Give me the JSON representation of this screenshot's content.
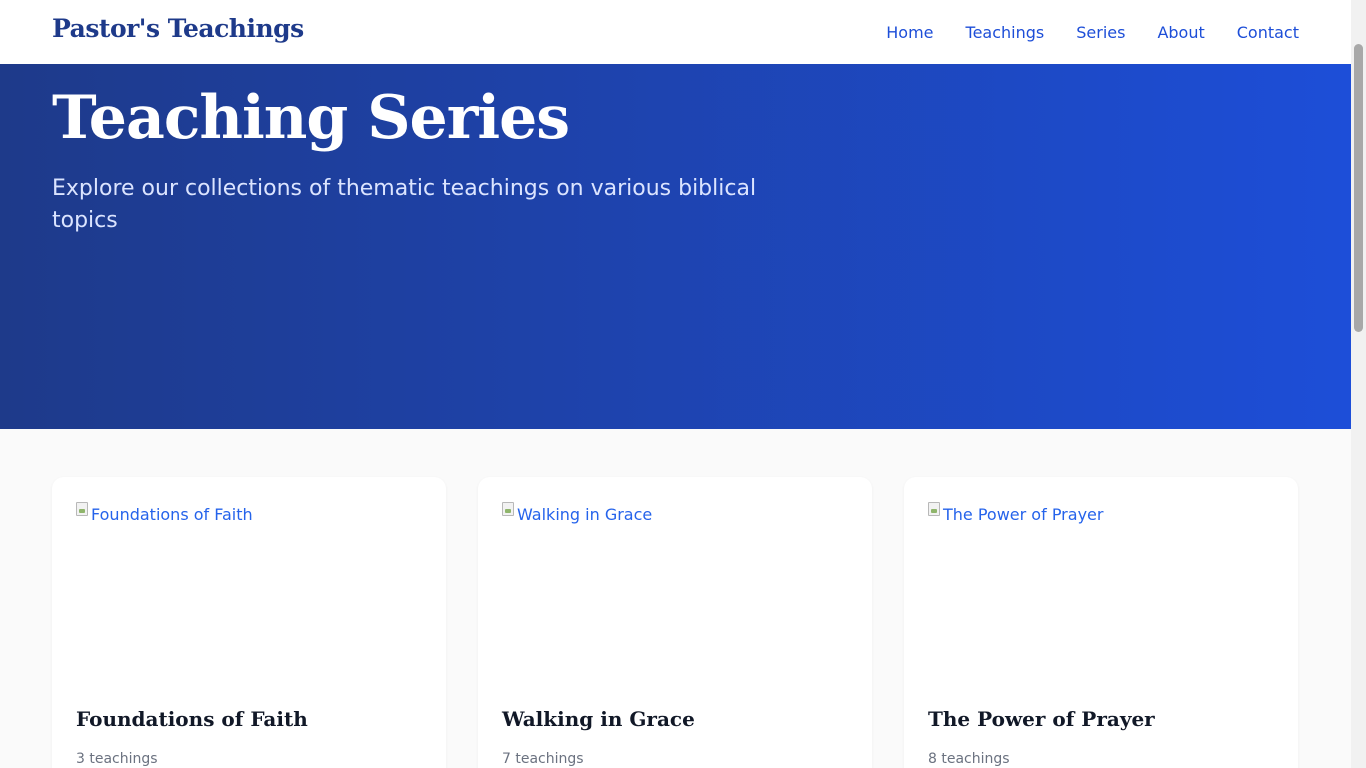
{
  "header": {
    "logo": "Pastor's Teachings",
    "nav": [
      {
        "label": "Home"
      },
      {
        "label": "Teachings"
      },
      {
        "label": "Series"
      },
      {
        "label": "About"
      },
      {
        "label": "Contact"
      }
    ]
  },
  "hero": {
    "title": "Teaching Series",
    "subtitle": "Explore our collections of thematic teachings on various biblical topics"
  },
  "series": [
    {
      "image_alt": "Foundations of Faith",
      "title": "Foundations of Faith",
      "count": "3 teachings"
    },
    {
      "image_alt": "Walking in Grace",
      "title": "Walking in Grace",
      "count": "7 teachings"
    },
    {
      "image_alt": "The Power of Prayer",
      "title": "The Power of Prayer",
      "count": "8 teachings"
    }
  ],
  "colors": {
    "brand": "#1e3a8a",
    "accent": "#1d4ed8",
    "hero_gradient_start": "#1e3a8a",
    "hero_gradient_end": "#1d4ed8"
  }
}
